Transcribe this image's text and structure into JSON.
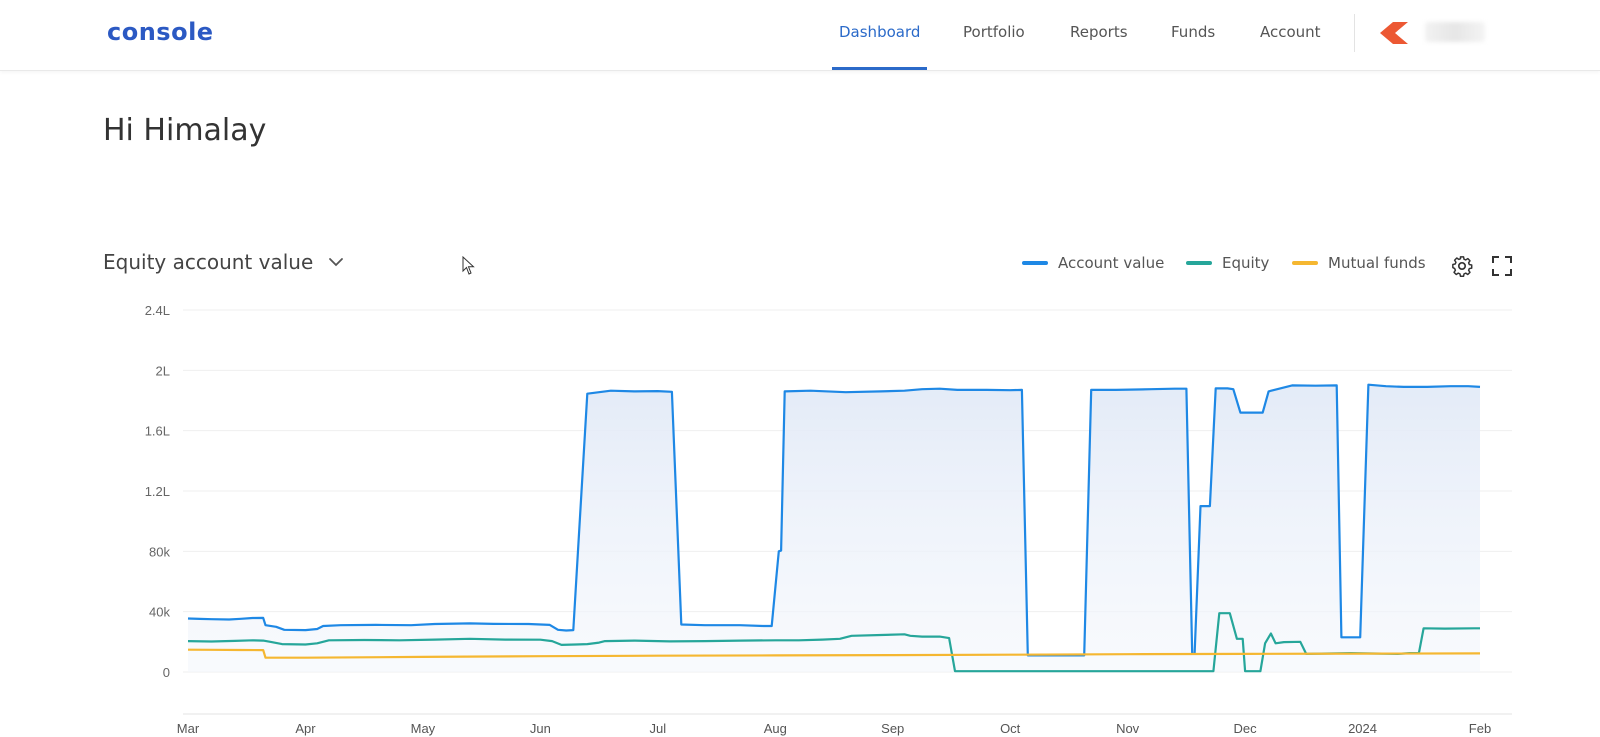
{
  "header": {
    "logo": "console",
    "nav": [
      {
        "label": "Dashboard",
        "active": true
      },
      {
        "label": "Portfolio",
        "active": false
      },
      {
        "label": "Reports",
        "active": false
      },
      {
        "label": "Funds",
        "active": false
      },
      {
        "label": "Account",
        "active": false
      }
    ]
  },
  "greeting": "Hi Himalay",
  "chart_selector": {
    "label": "Equity account value",
    "icon": "chevron-down-icon"
  },
  "toolbar": {
    "settings_icon": "gear-icon",
    "fullscreen_icon": "fullscreen-icon"
  },
  "colors": {
    "accent": "#2b6ac9",
    "account_value": "#1e88e5",
    "equity": "#26a69a",
    "mutual_funds": "#f5b731",
    "kite": "#ec5833"
  },
  "chart_data": {
    "type": "line",
    "title": "",
    "xlabel": "",
    "ylabel": "",
    "y_tick_labels": [
      "0",
      "40k",
      "80k",
      "1.2L",
      "1.6L",
      "2L",
      "2.4L"
    ],
    "x_tick_labels": [
      "Mar",
      "Apr",
      "May",
      "Jun",
      "Jul",
      "Aug",
      "Sep",
      "Oct",
      "Nov",
      "Dec",
      "2024",
      "Feb"
    ],
    "grid": true,
    "legend_position": "top-right",
    "series": [
      {
        "name": "Account value",
        "color": "#1e88e5",
        "area": true,
        "points": [
          [
            0.0,
            35.5
          ],
          [
            0.1,
            35.2
          ],
          [
            0.2,
            35.0
          ],
          [
            0.35,
            34.8
          ],
          [
            0.45,
            35.3
          ],
          [
            0.55,
            35.8
          ],
          [
            0.64,
            35.9
          ],
          [
            0.66,
            31.0
          ],
          [
            0.75,
            30.0
          ],
          [
            0.82,
            28.0
          ],
          [
            1.0,
            27.8
          ],
          [
            1.1,
            28.5
          ],
          [
            1.15,
            30.5
          ],
          [
            1.3,
            31.0
          ],
          [
            1.6,
            31.2
          ],
          [
            1.9,
            31.0
          ],
          [
            2.1,
            31.8
          ],
          [
            2.4,
            32.2
          ],
          [
            2.6,
            31.9
          ],
          [
            2.9,
            31.8
          ],
          [
            3.08,
            31.2
          ],
          [
            3.15,
            28.0
          ],
          [
            3.22,
            27.5
          ],
          [
            3.28,
            27.8
          ],
          [
            3.4,
            184.5
          ],
          [
            3.6,
            186.5
          ],
          [
            3.8,
            186.0
          ],
          [
            4.0,
            186.2
          ],
          [
            4.12,
            185.8
          ],
          [
            4.2,
            31.5
          ],
          [
            4.4,
            31.0
          ],
          [
            4.7,
            31.0
          ],
          [
            4.9,
            30.5
          ],
          [
            4.97,
            30.5
          ],
          [
            5.03,
            80.0
          ],
          [
            5.05,
            80.5
          ],
          [
            5.08,
            186.0
          ],
          [
            5.3,
            186.5
          ],
          [
            5.6,
            185.5
          ],
          [
            5.9,
            186.0
          ],
          [
            6.1,
            186.5
          ],
          [
            6.25,
            187.5
          ],
          [
            6.4,
            187.8
          ],
          [
            6.55,
            187.0
          ],
          [
            6.8,
            187.0
          ],
          [
            7.0,
            186.8
          ],
          [
            7.1,
            187.0
          ],
          [
            7.15,
            11.0
          ],
          [
            7.63,
            11.0
          ],
          [
            7.69,
            187.0
          ],
          [
            7.9,
            187.0
          ],
          [
            8.2,
            187.5
          ],
          [
            8.4,
            187.8
          ],
          [
            8.5,
            187.8
          ],
          [
            8.55,
            12.0
          ],
          [
            8.57,
            12.0
          ],
          [
            8.62,
            110.0
          ],
          [
            8.7,
            110.0
          ],
          [
            8.75,
            188.0
          ],
          [
            8.85,
            188.0
          ],
          [
            8.9,
            187.5
          ],
          [
            8.96,
            172.0
          ],
          [
            9.1,
            172.0
          ],
          [
            9.15,
            172.0
          ],
          [
            9.2,
            186.0
          ],
          [
            9.4,
            190.0
          ],
          [
            9.6,
            189.8
          ],
          [
            9.78,
            190.0
          ],
          [
            9.82,
            23.0
          ],
          [
            9.98,
            23.0
          ],
          [
            10.05,
            190.5
          ],
          [
            10.2,
            189.5
          ],
          [
            10.35,
            189.0
          ],
          [
            10.55,
            189.0
          ],
          [
            10.75,
            189.5
          ],
          [
            10.9,
            189.5
          ],
          [
            11.0,
            189.0
          ]
        ]
      },
      {
        "name": "Equity",
        "color": "#26a69a",
        "area": false,
        "points": [
          [
            0.0,
            20.5
          ],
          [
            0.2,
            20.2
          ],
          [
            0.4,
            20.6
          ],
          [
            0.55,
            21.0
          ],
          [
            0.64,
            20.8
          ],
          [
            0.7,
            20.0
          ],
          [
            0.8,
            18.5
          ],
          [
            1.0,
            18.2
          ],
          [
            1.1,
            19.0
          ],
          [
            1.2,
            21.0
          ],
          [
            1.5,
            21.2
          ],
          [
            1.8,
            21.0
          ],
          [
            2.1,
            21.5
          ],
          [
            2.4,
            22.0
          ],
          [
            2.7,
            21.5
          ],
          [
            3.0,
            21.4
          ],
          [
            3.1,
            20.5
          ],
          [
            3.18,
            18.0
          ],
          [
            3.3,
            18.2
          ],
          [
            3.4,
            18.5
          ],
          [
            3.5,
            19.5
          ],
          [
            3.55,
            20.5
          ],
          [
            3.8,
            20.8
          ],
          [
            4.1,
            20.3
          ],
          [
            4.4,
            20.5
          ],
          [
            4.7,
            20.8
          ],
          [
            5.0,
            21.0
          ],
          [
            5.2,
            21.0
          ],
          [
            5.4,
            21.5
          ],
          [
            5.55,
            22.0
          ],
          [
            5.65,
            24.0
          ],
          [
            5.9,
            24.5
          ],
          [
            6.1,
            25.0
          ],
          [
            6.15,
            24.0
          ],
          [
            6.25,
            23.5
          ],
          [
            6.4,
            23.5
          ],
          [
            6.48,
            22.5
          ],
          [
            6.53,
            0.5
          ],
          [
            8.57,
            0.5
          ],
          [
            8.73,
            0.5
          ],
          [
            8.78,
            39.0
          ],
          [
            8.87,
            39.0
          ],
          [
            8.93,
            22.0
          ],
          [
            8.98,
            22.0
          ],
          [
            9.0,
            0.5
          ],
          [
            9.13,
            0.5
          ],
          [
            9.17,
            19.0
          ],
          [
            9.22,
            25.5
          ],
          [
            9.26,
            19.0
          ],
          [
            9.33,
            19.8
          ],
          [
            9.47,
            20.0
          ],
          [
            9.52,
            12.0
          ],
          [
            9.9,
            12.5
          ],
          [
            10.3,
            12.0
          ],
          [
            10.4,
            12.5
          ],
          [
            10.48,
            12.5
          ],
          [
            10.52,
            29.0
          ],
          [
            10.7,
            28.8
          ],
          [
            10.95,
            29.0
          ],
          [
            11.0,
            29.0
          ]
        ]
      },
      {
        "name": "Mutual funds",
        "color": "#f5b731",
        "area": false,
        "points": [
          [
            0.0,
            14.8
          ],
          [
            0.2,
            14.7
          ],
          [
            0.45,
            14.6
          ],
          [
            0.64,
            14.5
          ],
          [
            0.66,
            9.5
          ],
          [
            1.0,
            9.5
          ],
          [
            2.0,
            10.0
          ],
          [
            3.0,
            10.5
          ],
          [
            4.0,
            10.8
          ],
          [
            5.0,
            11.0
          ],
          [
            6.0,
            11.2
          ],
          [
            7.0,
            11.5
          ],
          [
            8.0,
            11.8
          ],
          [
            9.0,
            12.0
          ],
          [
            10.0,
            12.2
          ],
          [
            11.0,
            12.3
          ]
        ]
      }
    ]
  }
}
